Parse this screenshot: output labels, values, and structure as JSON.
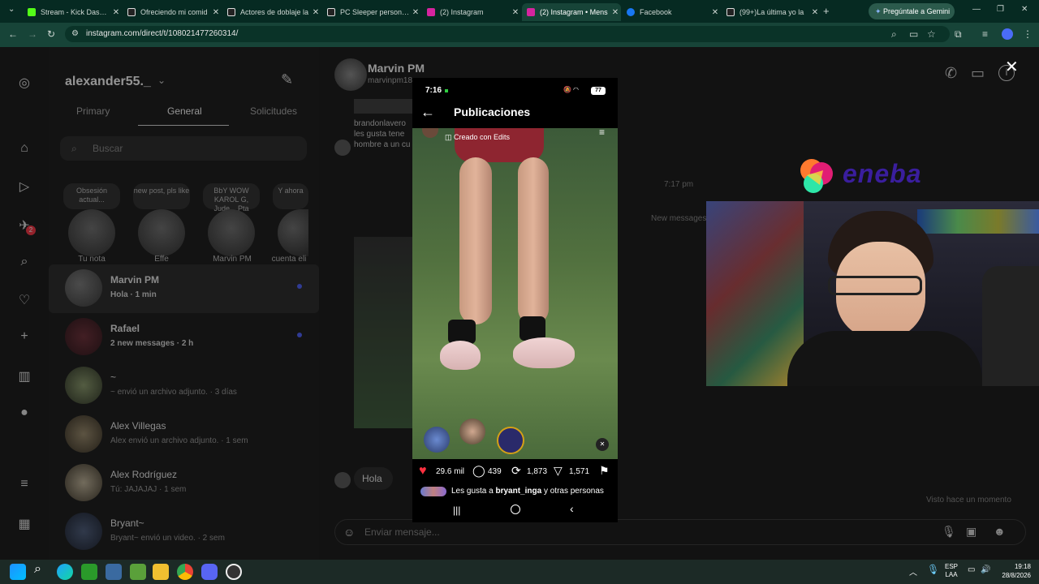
{
  "browser": {
    "tabs": [
      {
        "label": "Stream - Kick Dashbo",
        "color": "#53fc18"
      },
      {
        "label": "Ofreciendo mi comid",
        "color": "#111111"
      },
      {
        "label": "Actores de doblaje la",
        "color": "#111111"
      },
      {
        "label": "PC Sleeper personaliz",
        "color": "#111111"
      },
      {
        "label": "(2) Instagram",
        "color": "#d6249f"
      },
      {
        "label": "(2) Instagram • Mens",
        "color": "#d6249f"
      },
      {
        "label": "Facebook",
        "color": "#1877f2"
      },
      {
        "label": "(99+)La última yo la",
        "color": "#111111"
      }
    ],
    "gemini_label": "Pregúntale a Gemini",
    "url": "instagram.com/direct/t/108021477260314/"
  },
  "sidebar_list": {
    "username": "alexander55._",
    "tabs": [
      "Primary",
      "General",
      "Solicitudes"
    ],
    "search_placeholder": "Buscar",
    "notes": [
      {
        "text": "Obsesión actual...",
        "label": "Tu nota"
      },
      {
        "text": "new post, pls like",
        "label": "Effe"
      },
      {
        "text": "BbY WOW KAROL G, Jude... Pta música",
        "label": "Marvin PM"
      },
      {
        "text": "Y ahora",
        "label": "cuenta eli"
      }
    ],
    "conversations": [
      {
        "name": "Marvin PM",
        "sub": "Hola · 1 min",
        "unread": true
      },
      {
        "name": "Rafael",
        "sub": "2 new messages · 2 h",
        "unread": true
      },
      {
        "name": "~",
        "sub": "~ envió un archivo adjunto. · 3 días",
        "unread": false
      },
      {
        "name": "Alex Villegas",
        "sub": "Alex envió un archivo adjunto. · 1 sem",
        "unread": false
      },
      {
        "name": "Alex Rodríguez",
        "sub": "Tú: JAJAJAJ · 1 sem",
        "unread": false
      },
      {
        "name": "Bryant~",
        "sub": "Bryant~ envió un video. · 2 sem",
        "unread": false
      }
    ]
  },
  "chat": {
    "name": "Marvin PM",
    "handle": "marvinpm18",
    "preview_text": "brandonlavero les gusta tene hombre a un cu",
    "time": "7:17 pm",
    "new_messages": "New messages",
    "hola": "Hola",
    "seen": "Visto hace un momento",
    "input_placeholder": "Enviar mensaje..."
  },
  "phone": {
    "time": "7:16",
    "battery": "77",
    "header": "Publicaciones",
    "created_with": "Creado con Edits",
    "likes": "29.6 mil",
    "comments": "439",
    "reposts": "1,873",
    "shares": "1,571",
    "liked_by_prefix": "Les gusta a ",
    "liked_by_user": "bryant_inga",
    "liked_by_suffix": " y otras personas"
  },
  "overlay": {
    "brand": "eneba"
  },
  "taskbar": {
    "lang": "ESP",
    "region": "LAA",
    "time": "19:18",
    "date": "28/8/2026"
  }
}
